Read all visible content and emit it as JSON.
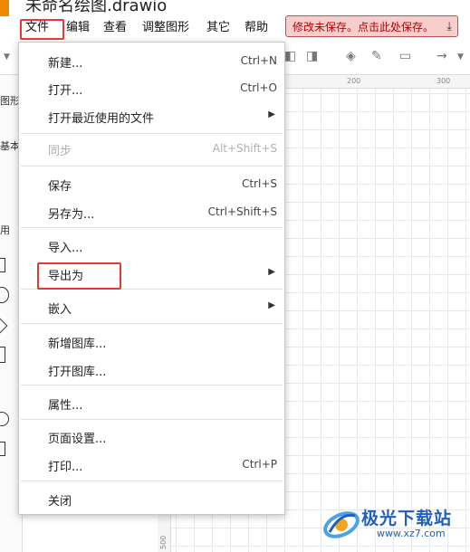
{
  "title": {
    "doc_name": "未命名绘图.drawio"
  },
  "menubar": {
    "items": [
      "文件",
      "编辑",
      "查看",
      "调整图形",
      "其它",
      "帮助"
    ],
    "unsaved_banner": "修改未保存。点击此处保存。",
    "download_icon": "download-icon"
  },
  "sidebar": {
    "fragments": [
      "图形",
      "基本",
      "用"
    ]
  },
  "ruler": {
    "top_labels": [
      "200",
      "300"
    ],
    "left_label": "500"
  },
  "file_menu": {
    "items": [
      {
        "label": "新建...",
        "shortcut": "Ctrl+N",
        "submenu": false,
        "disabled": false
      },
      {
        "label": "打开...",
        "shortcut": "Ctrl+O",
        "submenu": false,
        "disabled": false
      },
      {
        "label": "打开最近使用的文件",
        "shortcut": "",
        "submenu": true,
        "disabled": false
      },
      {
        "label": "同步",
        "shortcut": "Alt+Shift+S",
        "submenu": false,
        "disabled": true
      },
      {
        "label": "保存",
        "shortcut": "Ctrl+S",
        "submenu": false,
        "disabled": false
      },
      {
        "label": "另存为...",
        "shortcut": "Ctrl+Shift+S",
        "submenu": false,
        "disabled": false
      },
      {
        "label": "导入...",
        "shortcut": "",
        "submenu": false,
        "disabled": false
      },
      {
        "label": "导出为",
        "shortcut": "",
        "submenu": true,
        "disabled": false
      },
      {
        "label": "嵌入",
        "shortcut": "",
        "submenu": true,
        "disabled": false
      },
      {
        "label": "新增图库...",
        "shortcut": "",
        "submenu": false,
        "disabled": false
      },
      {
        "label": "打开图库...",
        "shortcut": "",
        "submenu": false,
        "disabled": false
      },
      {
        "label": "属性...",
        "shortcut": "",
        "submenu": false,
        "disabled": false
      },
      {
        "label": "页面设置...",
        "shortcut": "",
        "submenu": false,
        "disabled": false
      },
      {
        "label": "打印...",
        "shortcut": "Ctrl+P",
        "submenu": false,
        "disabled": false
      },
      {
        "label": "关闭",
        "shortcut": "",
        "submenu": false,
        "disabled": false
      }
    ]
  },
  "watermark": {
    "text": "极光下载站",
    "url": "www.xz7.com"
  },
  "colors": {
    "annotation": "#e53935",
    "banner_bg": "#f8cecc",
    "banner_text": "#b20000",
    "logo": "#f08705"
  }
}
